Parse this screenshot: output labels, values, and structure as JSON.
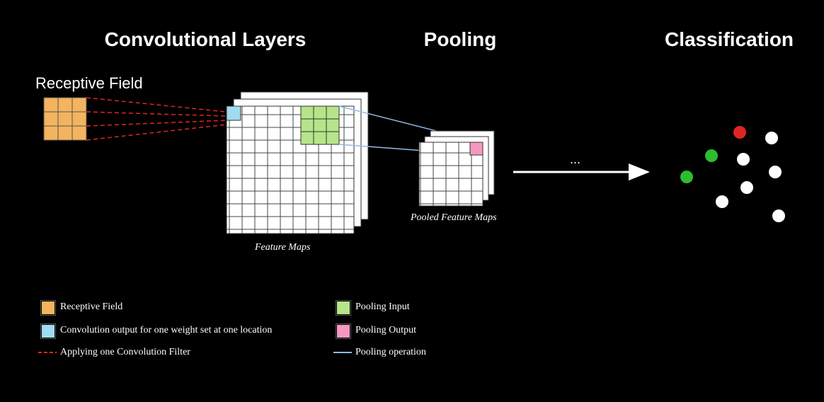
{
  "titles": {
    "conv": "Convolutional Layers",
    "pool": "Pooling",
    "cls": "Classification"
  },
  "captions": {
    "receptive": "Receptive Field",
    "feature_maps": "Feature Maps",
    "pooled_maps": "Pooled Feature Maps"
  },
  "legend": {
    "l1": "Receptive Field",
    "l2": "Convolution output for one weight set at one location",
    "l3": "Applying one Convolution Filter",
    "r1": "Pooling Input",
    "r2": "Pooling Output",
    "r3": "Pooling operation"
  },
  "colors": {
    "orange": "#f4b35e",
    "cyan": "#a1dbf1",
    "green_light": "#b6e589",
    "pink": "#f598c2",
    "red": "#e12522",
    "blue_line": "#93b9e6",
    "node_green": "#2dbd2d",
    "node_red": "#e02522",
    "node_white": "#ffffff"
  },
  "arrow_label": "..."
}
